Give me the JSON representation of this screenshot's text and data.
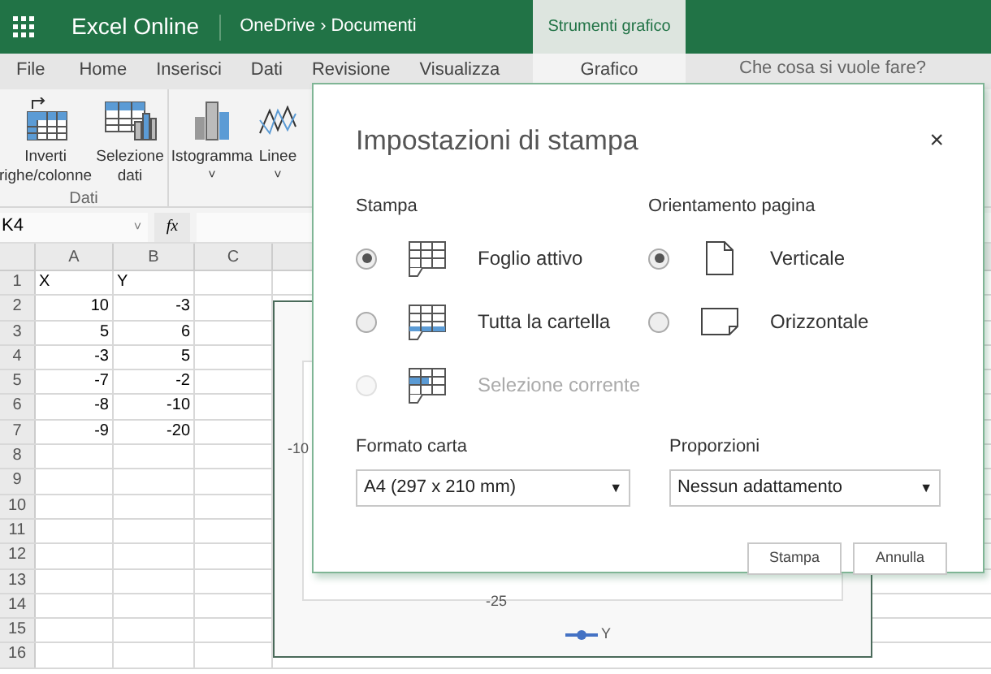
{
  "topbar": {
    "app_title": "Excel Online",
    "breadcrumb": [
      "OneDrive",
      "Documenti"
    ],
    "separator": "›",
    "context_tab": "Strumenti grafico"
  },
  "menu": [
    {
      "label": "File",
      "selected": false
    },
    {
      "label": "Home",
      "selected": false
    },
    {
      "label": "Inserisci",
      "selected": false
    },
    {
      "label": "Dati",
      "selected": false
    },
    {
      "label": "Revisione",
      "selected": false
    },
    {
      "label": "Visualizza",
      "selected": false
    },
    {
      "label": "Grafico",
      "selected": true
    }
  ],
  "tell_me": "Che cosa si vuole fare?",
  "ribbon": [
    {
      "label": "Dati",
      "buttons": [
        {
          "label": "Inverti righe/colonne",
          "kind": "swap"
        },
        {
          "label": "Selezione dati",
          "kind": "select-data"
        }
      ]
    },
    {
      "buttons": [
        {
          "label": "Istogramma",
          "kind": "column-chart",
          "caret": "˅"
        },
        {
          "label": "Linee",
          "kind": "line-chart",
          "caret": "˅"
        }
      ]
    }
  ],
  "formula_bar": {
    "name_box": "K4",
    "caret": "˅",
    "function_label": "fx"
  },
  "sheet": {
    "columns": [
      "A",
      "B",
      "C"
    ],
    "rows": [
      {
        "header": "1",
        "cells": [
          {
            "value": "X",
            "kind": "text"
          },
          {
            "value": "Y",
            "kind": "text"
          }
        ]
      },
      {
        "header": "2",
        "cells": [
          {
            "value": "10",
            "kind": "number"
          },
          {
            "value": "-3",
            "kind": "number"
          }
        ]
      },
      {
        "header": "3",
        "cells": [
          {
            "value": "5",
            "kind": "number"
          },
          {
            "value": "6",
            "kind": "number"
          }
        ]
      },
      {
        "header": "4",
        "cells": [
          {
            "value": "-3",
            "kind": "number"
          },
          {
            "value": "5",
            "kind": "number"
          }
        ]
      },
      {
        "header": "5",
        "cells": [
          {
            "value": "-7",
            "kind": "number"
          },
          {
            "value": "-2",
            "kind": "number"
          }
        ]
      },
      {
        "header": "6",
        "cells": [
          {
            "value": "-8",
            "kind": "number"
          },
          {
            "value": "-10",
            "kind": "number"
          }
        ]
      },
      {
        "header": "7",
        "cells": [
          {
            "value": "-9",
            "kind": "number"
          },
          {
            "value": "-20",
            "kind": "number"
          }
        ]
      },
      {
        "header": "8",
        "cells": []
      },
      {
        "header": "9",
        "cells": []
      },
      {
        "header": "10",
        "cells": []
      },
      {
        "header": "11",
        "cells": []
      },
      {
        "header": "12",
        "cells": []
      },
      {
        "header": "13",
        "cells": []
      },
      {
        "header": "14",
        "cells": []
      },
      {
        "header": "15",
        "cells": []
      },
      {
        "header": "16",
        "cells": []
      }
    ]
  },
  "chart": {
    "y_label": "-10",
    "x_label": "-25",
    "legend": "Y"
  },
  "dialog": {
    "title": "Impostazioni di stampa",
    "close": "×",
    "print_section": {
      "label": "Stampa",
      "options": [
        {
          "label": "Foglio attivo",
          "kind": "sheet",
          "selected": true,
          "disabled": false
        },
        {
          "label": "Tutta la cartella",
          "kind": "workbook",
          "selected": false,
          "disabled": false
        },
        {
          "label": "Selezione corrente",
          "kind": "selection",
          "selected": false,
          "disabled": true
        }
      ]
    },
    "orientation_section": {
      "label": "Orientamento pagina",
      "options": [
        {
          "label": "Verticale",
          "kind": "portrait",
          "selected": true,
          "disabled": false
        },
        {
          "label": "Orizzontale",
          "kind": "landscape",
          "selected": false,
          "disabled": false
        }
      ]
    },
    "paper": {
      "label": "Formato carta",
      "value": "A4 (297 x 210 mm)",
      "arrow": "▼"
    },
    "scaling": {
      "label": "Proporzioni",
      "value": "Nessun adattamento",
      "arrow": "▼"
    },
    "buttons": [
      "Stampa",
      "Annulla"
    ]
  }
}
